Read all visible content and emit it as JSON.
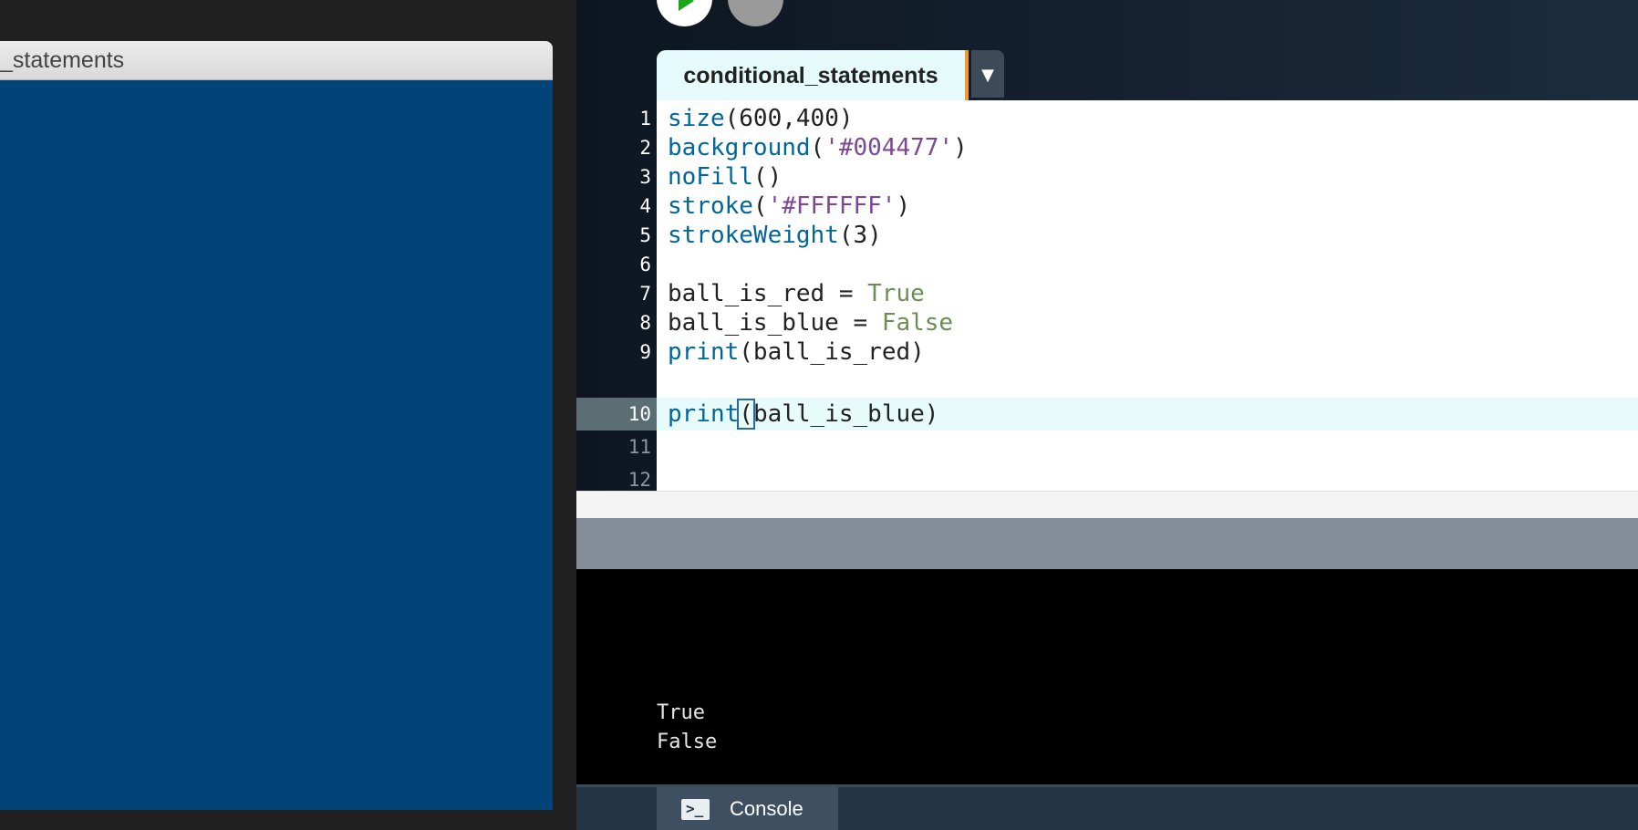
{
  "sketch_window": {
    "title": "_statements",
    "canvas_color": "#004477"
  },
  "toolbar": {
    "run_icon": "play-icon",
    "stop_icon": "stop-icon"
  },
  "editor": {
    "tab_label": "conditional_statements",
    "dropdown_glyph": "▼",
    "active_line": 10,
    "lines": [
      {
        "n": "1",
        "code": "size(600,400)"
      },
      {
        "n": "2",
        "code": "background('#004477')"
      },
      {
        "n": "3",
        "code": "noFill()"
      },
      {
        "n": "4",
        "code": "stroke('#FFFFFF')"
      },
      {
        "n": "5",
        "code": "strokeWeight(3)"
      },
      {
        "n": "6",
        "code": ""
      },
      {
        "n": "7",
        "code": "ball_is_red = True"
      },
      {
        "n": "8",
        "code": "ball_is_blue = False"
      },
      {
        "n": "9",
        "code": "print(ball_is_red)"
      },
      {
        "n": "10",
        "code": "print(ball_is_blue)"
      },
      {
        "n": "11",
        "code": ""
      },
      {
        "n": "12",
        "code": ""
      }
    ]
  },
  "console": {
    "output": [
      "True",
      "False"
    ],
    "tab_label": "Console",
    "tab_icon": "terminal-icon",
    "icon_glyph": ">_"
  }
}
